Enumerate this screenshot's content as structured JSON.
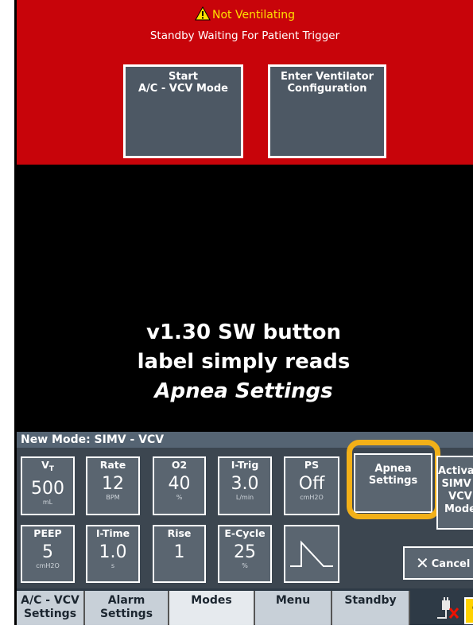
{
  "alarm": {
    "title": "Not Ventilating",
    "status": "Standby Waiting For Patient Trigger",
    "start_button": "Start\nA/C - VCV Mode",
    "config_button": "Enter Ventilator\nConfiguration"
  },
  "annotation": {
    "line1": "v1.30 SW button",
    "line2": "label simply reads",
    "line3": "Apnea Settings"
  },
  "mode_header": "New Mode: SIMV - VCV",
  "controls": [
    {
      "label": "V",
      "label_sub": "T",
      "value": "500",
      "unit": "mL"
    },
    {
      "label": "Rate",
      "value": "12",
      "unit": "BPM"
    },
    {
      "label": "O2",
      "value": "40",
      "unit": "%"
    },
    {
      "label": "I-Trig",
      "value": "3.0",
      "unit": "L/min"
    },
    {
      "label": "PS",
      "value": "Off",
      "unit": "cmH2O"
    },
    {
      "label": "PEEP",
      "value": "5",
      "unit": "cmH2O"
    },
    {
      "label": "I-Time",
      "value": "1.0",
      "unit": "s"
    },
    {
      "label": "Rise",
      "value": "1",
      "unit": ""
    },
    {
      "label": "E-Cycle",
      "value": "25",
      "unit": "%"
    }
  ],
  "apnea_button": "Apnea\nSettings",
  "activate_button": "Activate\nSIMV -\nVCV\nMode",
  "cancel_button": "Cancel",
  "tabs": [
    {
      "label": "A/C - VCV\nSettings"
    },
    {
      "label": "Alarm\nSettings"
    },
    {
      "label": "Modes"
    },
    {
      "label": "Menu"
    },
    {
      "label": "Standby"
    }
  ],
  "help_symbol": "?",
  "colors": {
    "alarm_red": "#c8040a",
    "warning_yellow": "#ffe100",
    "highlight": "#f2b018",
    "button_gray": "#5a6570"
  },
  "icons": [
    "warning-icon",
    "pressure-waveform-icon",
    "close-icon",
    "power-plug-icon",
    "help-icon"
  ]
}
